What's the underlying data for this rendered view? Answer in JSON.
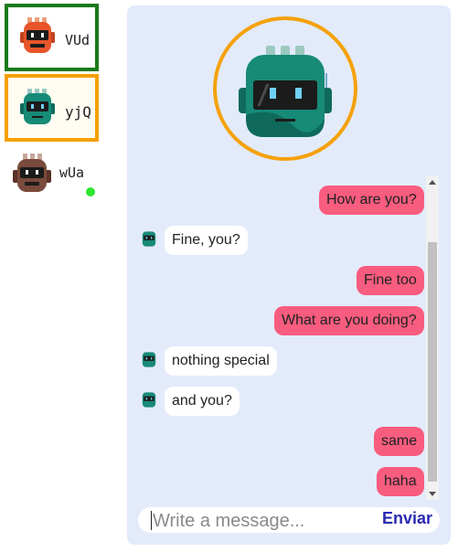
{
  "contacts": [
    {
      "name": "VUd",
      "color": "#e8552b",
      "border": "#1a7a1a"
    },
    {
      "name": "yjQ",
      "color": "#178a78",
      "border": "#f5a000"
    },
    {
      "name": "wUa",
      "color": "#7a4a3c",
      "status": "online"
    }
  ],
  "chat": {
    "avatar": "robot-avatar",
    "messages": [
      {
        "from": "me",
        "text": "How are you?"
      },
      {
        "from": "them",
        "text": "Fine, you?"
      },
      {
        "from": "me",
        "text": "Fine too"
      },
      {
        "from": "me",
        "text": "What are you doing?"
      },
      {
        "from": "them",
        "text": "nothing special"
      },
      {
        "from": "them",
        "text": "and you?"
      },
      {
        "from": "me",
        "text": "same"
      },
      {
        "from": "me",
        "text": "haha"
      }
    ]
  },
  "composer": {
    "placeholder": "Write a message...",
    "send_label": "Enviar"
  },
  "colors": {
    "outgoing": "#f85c7e",
    "incoming": "#ffffff",
    "panel": "#e3ebfb",
    "send": "#2a2ab0"
  }
}
